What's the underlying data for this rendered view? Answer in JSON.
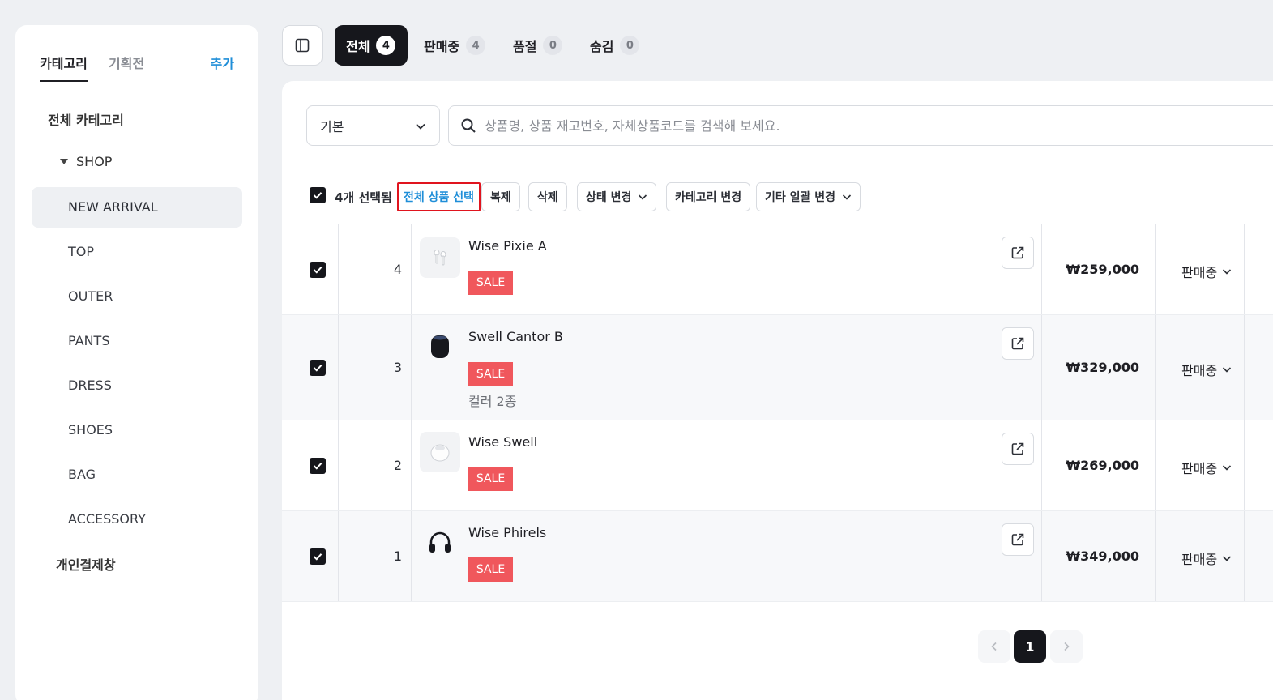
{
  "sidebar": {
    "tabs": [
      "카테고리",
      "기획전"
    ],
    "add_label": "추가",
    "all_categories": "전체 카테고리",
    "shop_label": "SHOP",
    "items": [
      "NEW ARRIVAL",
      "TOP",
      "OUTER",
      "PANTS",
      "DRESS",
      "SHOES",
      "BAG",
      "ACCESSORY"
    ],
    "personal_payment": "개인결제창"
  },
  "top_tabs": [
    {
      "label": "전체",
      "count": "4"
    },
    {
      "label": "판매중",
      "count": "4"
    },
    {
      "label": "품절",
      "count": "0"
    },
    {
      "label": "숨김",
      "count": "0"
    }
  ],
  "filter": {
    "select_value": "기본",
    "search_placeholder": "상품명, 상품 재고번호, 자체상품코드를 검색해 보세요."
  },
  "toolbar": {
    "selected_text": "4개 선택됨",
    "select_all": "전체 상품 선택",
    "duplicate": "복제",
    "delete": "삭제",
    "status_change": "상태 변경",
    "category_change": "카테고리 변경",
    "bulk_change": "기타 일괄 변경"
  },
  "products": [
    {
      "num": "4",
      "name": "Wise Pixie A",
      "badge": "SALE",
      "variant": "",
      "price": "₩259,000",
      "status": "판매중",
      "icon": "earbuds-icon"
    },
    {
      "num": "3",
      "name": "Swell Cantor B",
      "badge": "SALE",
      "variant": "컬러 2종",
      "price": "₩329,000",
      "status": "판매중",
      "icon": "smart-speaker-icon"
    },
    {
      "num": "2",
      "name": "Wise Swell",
      "badge": "SALE",
      "variant": "",
      "price": "₩269,000",
      "status": "판매중",
      "icon": "mini-speaker-icon"
    },
    {
      "num": "1",
      "name": "Wise Phirels",
      "badge": "SALE",
      "variant": "",
      "price": "₩349,000",
      "status": "판매중",
      "icon": "headphones-icon"
    }
  ],
  "pagination": {
    "current": "1"
  },
  "colors": {
    "accent": "#1f8ed8",
    "sale": "#f0575c",
    "dark": "#16171c",
    "highlight_border": "#e0141e"
  }
}
